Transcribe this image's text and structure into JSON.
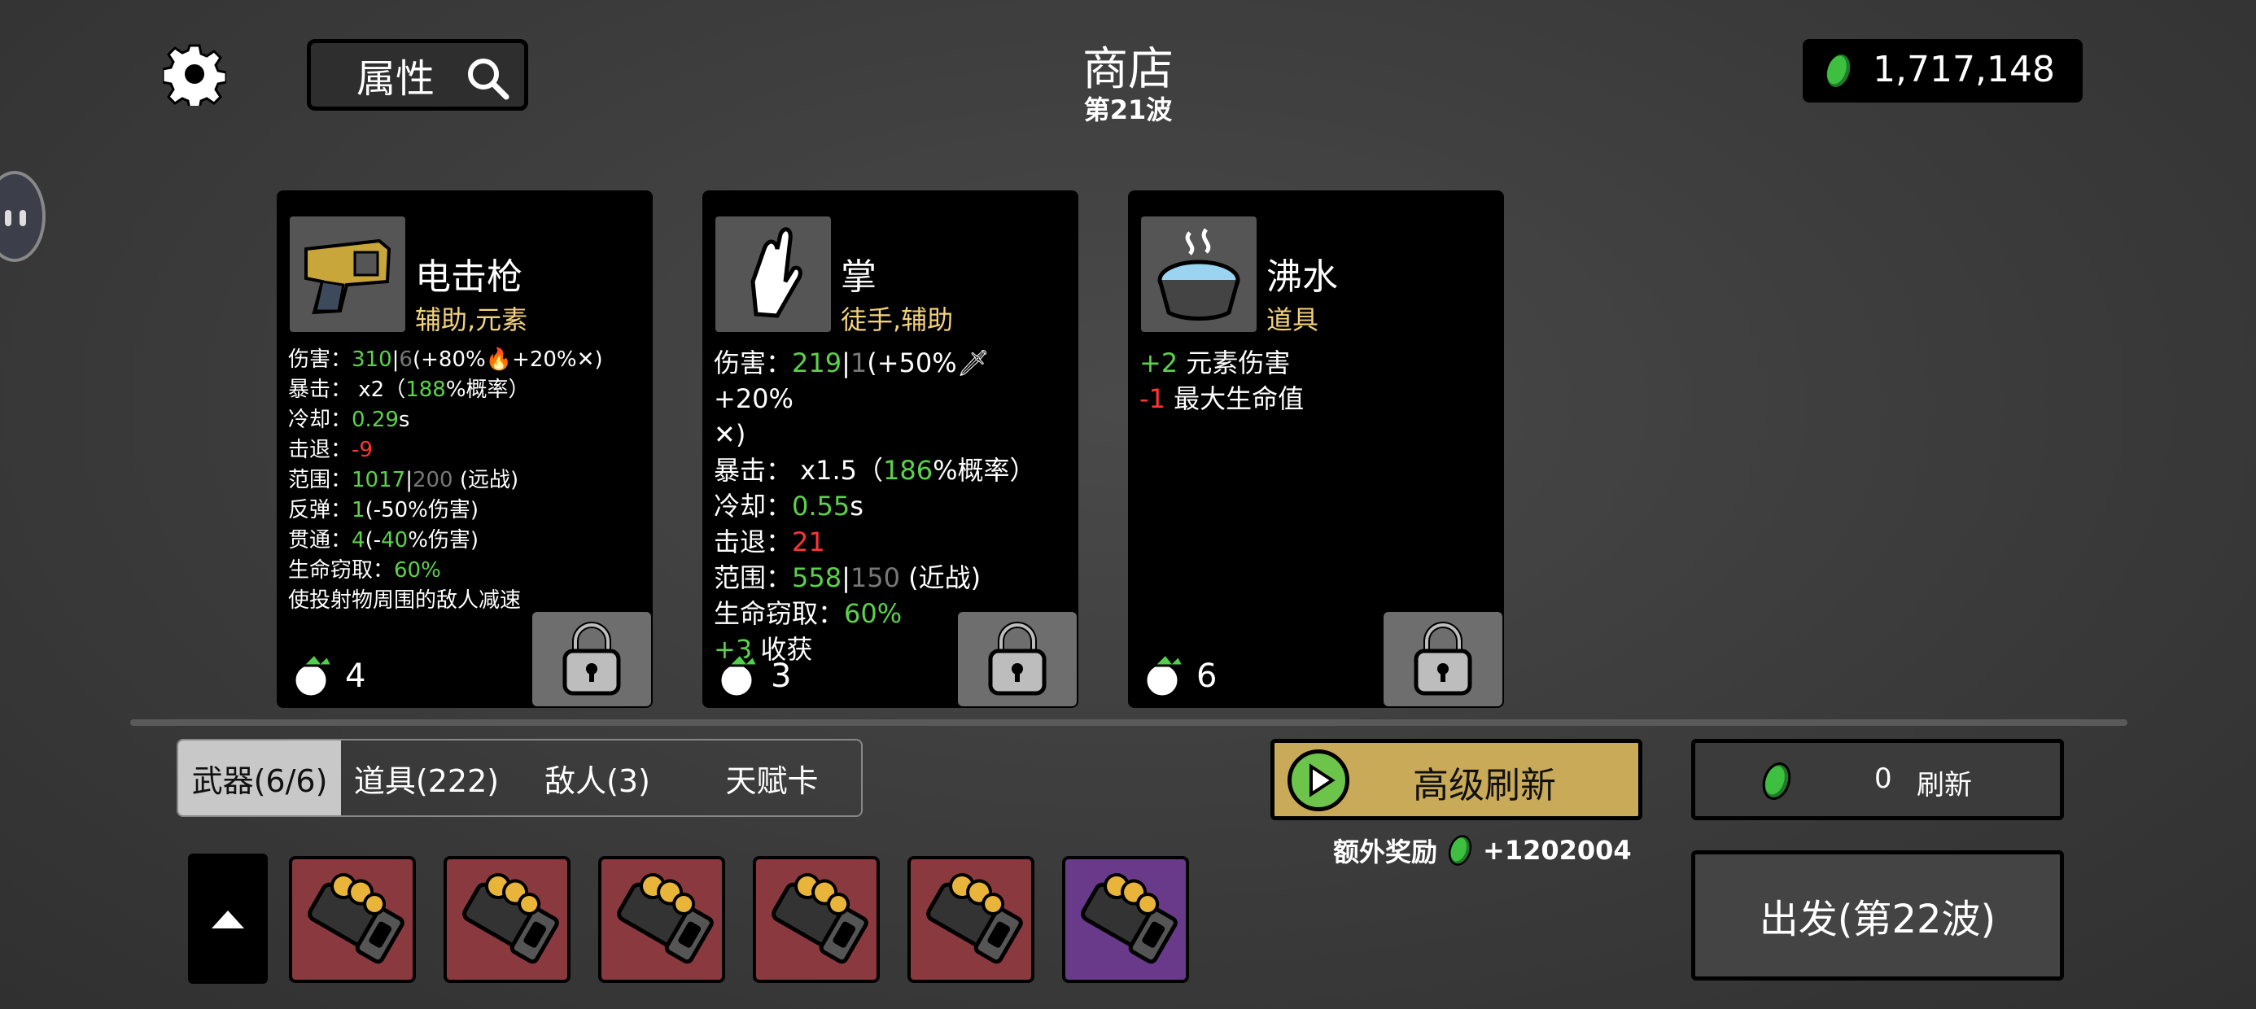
{
  "top": {
    "attributes_label": "属性",
    "title": "商店",
    "wave": "第21波",
    "money": "1,717,148"
  },
  "cards": [
    {
      "name": "电击枪",
      "tags": "辅助,元素",
      "count": "4",
      "stats": [
        [
          [
            "伤害：",
            ""
          ],
          [
            "310",
            "g"
          ],
          [
            "|",
            ""
          ],
          [
            "6",
            "gr"
          ],
          [
            "(+80%",
            ""
          ],
          [
            "🔥",
            ""
          ],
          [
            "+20%",
            ""
          ],
          [
            "✕",
            ""
          ],
          [
            ")",
            ""
          ]
        ],
        [
          [
            "暴击： x2（",
            ""
          ],
          [
            "188",
            "g"
          ],
          [
            "%概率）",
            ""
          ]
        ],
        [
          [
            "冷却：",
            ""
          ],
          [
            "0.29",
            "g"
          ],
          [
            "s",
            ""
          ]
        ],
        [
          [
            "击退：",
            ""
          ],
          [
            "-9",
            "r"
          ]
        ],
        [
          [
            "范围：",
            ""
          ],
          [
            "1017",
            "g"
          ],
          [
            "|",
            ""
          ],
          [
            "200",
            "gr"
          ],
          [
            " (远战)",
            ""
          ]
        ],
        [
          [
            "反弹：",
            ""
          ],
          [
            "1",
            "g"
          ],
          [
            "(-50%伤害)",
            ""
          ]
        ],
        [
          [
            "贯通：",
            ""
          ],
          [
            "4",
            "g"
          ],
          [
            "(-",
            ""
          ],
          [
            "40",
            "g"
          ],
          [
            "%伤害)",
            ""
          ]
        ],
        [
          [
            "生命窃取：",
            ""
          ],
          [
            "60%",
            "g"
          ]
        ],
        [
          [
            "使投射物周围的敌人减速",
            ""
          ]
        ]
      ]
    },
    {
      "name": "掌",
      "tags": "徒手,辅助",
      "count": "3",
      "stats": [
        [
          [
            "伤害：",
            ""
          ],
          [
            "219",
            "g"
          ],
          [
            "|",
            ""
          ],
          [
            "1",
            "gr"
          ],
          [
            "(+50%",
            ""
          ],
          [
            "🗡",
            ""
          ],
          [
            "+20%",
            ""
          ]
        ],
        [
          [
            "✕",
            ""
          ],
          [
            ")",
            ""
          ]
        ],
        [
          [
            "暴击： x1.5（",
            ""
          ],
          [
            "186",
            "g"
          ],
          [
            "%概率）",
            ""
          ]
        ],
        [
          [
            "冷却：",
            ""
          ],
          [
            "0.55",
            "g"
          ],
          [
            "s",
            ""
          ]
        ],
        [
          [
            "击退：",
            ""
          ],
          [
            "21",
            "r"
          ]
        ],
        [
          [
            "范围：",
            ""
          ],
          [
            "558",
            "g"
          ],
          [
            "|",
            ""
          ],
          [
            "150",
            "gr"
          ],
          [
            " (近战)",
            ""
          ]
        ],
        [
          [
            "生命窃取：",
            ""
          ],
          [
            "60%",
            "g"
          ]
        ],
        [
          [
            "+3",
            "g"
          ],
          [
            " 收获",
            ""
          ]
        ]
      ]
    },
    {
      "name": "沸水",
      "tags": "道具",
      "count": "6",
      "stats": [
        [
          [
            "+2",
            "g"
          ],
          [
            " 元素伤害",
            ""
          ]
        ],
        [
          [
            "-1",
            "r"
          ],
          [
            " 最大生命值",
            ""
          ]
        ]
      ]
    }
  ],
  "tabs": [
    "武器(6/6)",
    "道具(222)",
    "敌人(3)",
    "天赋卡"
  ],
  "inventory_colors": [
    "#8a3a3e",
    "#8a3a3e",
    "#8a3a3e",
    "#8a3a3e",
    "#8a3a3e",
    "#6a3a8a"
  ],
  "advanced_refresh": "高级刷新",
  "bonus_label": "额外奖励",
  "bonus_value": "+1202004",
  "refresh_count": "0",
  "refresh_label": "刷新",
  "go_label": "出发(第22波)"
}
